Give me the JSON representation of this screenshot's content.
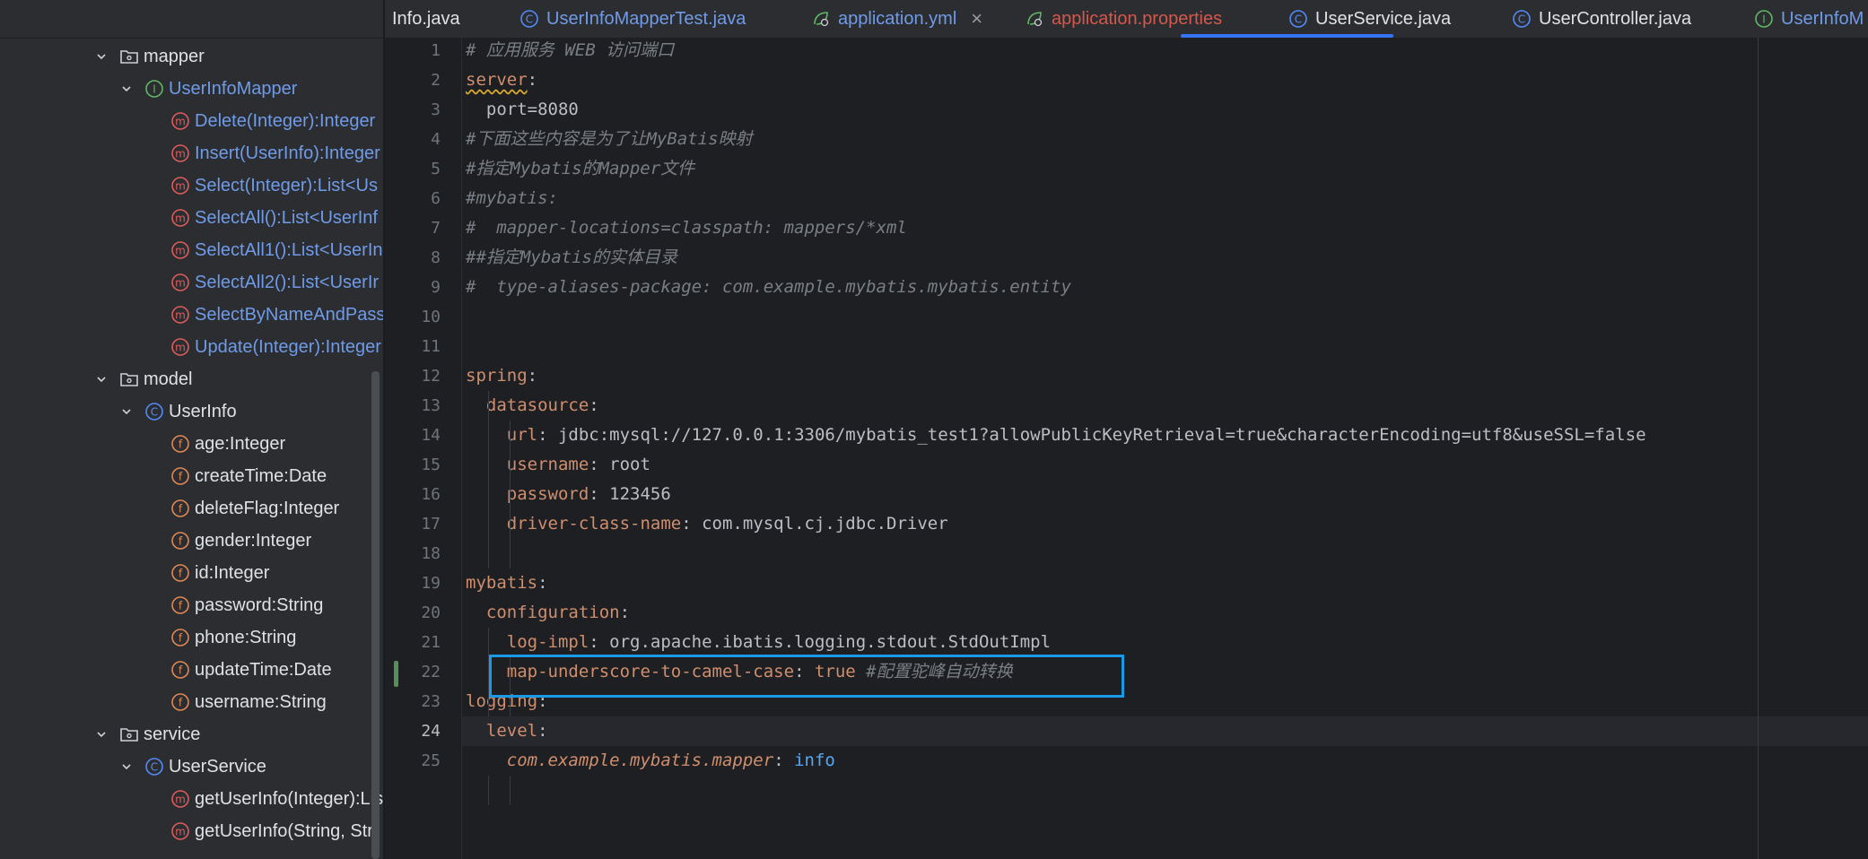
{
  "tabs": [
    {
      "label": "Info.java",
      "icon": "none",
      "color": "#dfe1e5"
    },
    {
      "label": "UserInfoMapperTest.java",
      "icon": "class-icon",
      "color": "#6f9be8"
    },
    {
      "label": "application.yml",
      "icon": "spring-config-icon",
      "color": "#6f9be8",
      "active": true,
      "close": "×"
    },
    {
      "label": "application.properties",
      "icon": "spring-config-icon",
      "color": "#d4584b"
    },
    {
      "label": "UserService.java",
      "icon": "class-icon",
      "color": "#dfe1e5"
    },
    {
      "label": "UserController.java",
      "icon": "class-icon",
      "color": "#dfe1e5"
    },
    {
      "label": "UserInfoM",
      "icon": "interface-icon",
      "color": "#6f9be8"
    }
  ],
  "tree": [
    {
      "label": "mapper",
      "type": "folder",
      "chevron": "down",
      "color": "#dfe1e5"
    },
    {
      "label": "UserInfoMapper",
      "type": "interface",
      "chevron": "down",
      "color": "#6f9be8"
    },
    {
      "label": "Delete(Integer):Integer",
      "type": "method",
      "color": "#6f9be8"
    },
    {
      "label": "Insert(UserInfo):Integer",
      "type": "method",
      "color": "#6f9be8"
    },
    {
      "label": "Select(Integer):List<Us",
      "type": "method",
      "color": "#6f9be8"
    },
    {
      "label": "SelectAll():List<UserInf",
      "type": "method",
      "color": "#6f9be8"
    },
    {
      "label": "SelectAll1():List<UserIn",
      "type": "method",
      "color": "#6f9be8"
    },
    {
      "label": "SelectAll2():List<UserIr",
      "type": "method",
      "color": "#6f9be8"
    },
    {
      "label": "SelectByNameAndPass",
      "type": "method",
      "color": "#6f9be8"
    },
    {
      "label": "Update(Integer):Integer",
      "type": "method",
      "color": "#6f9be8"
    },
    {
      "label": "model",
      "type": "folder",
      "chevron": "down",
      "color": "#dfe1e5"
    },
    {
      "label": "UserInfo",
      "type": "class",
      "chevron": "down",
      "color": "#dfe1e5"
    },
    {
      "label": "age:Integer",
      "type": "field",
      "color": "#dfe1e5"
    },
    {
      "label": "createTime:Date",
      "type": "field",
      "color": "#dfe1e5"
    },
    {
      "label": "deleteFlag:Integer",
      "type": "field",
      "color": "#dfe1e5"
    },
    {
      "label": "gender:Integer",
      "type": "field",
      "color": "#dfe1e5"
    },
    {
      "label": "id:Integer",
      "type": "field",
      "color": "#dfe1e5"
    },
    {
      "label": "password:String",
      "type": "field",
      "color": "#dfe1e5"
    },
    {
      "label": "phone:String",
      "type": "field",
      "color": "#dfe1e5"
    },
    {
      "label": "updateTime:Date",
      "type": "field",
      "color": "#dfe1e5"
    },
    {
      "label": "username:String",
      "type": "field",
      "color": "#dfe1e5"
    },
    {
      "label": "service",
      "type": "folder",
      "chevron": "down",
      "color": "#dfe1e5"
    },
    {
      "label": "UserService",
      "type": "class",
      "chevron": "down",
      "color": "#dfe1e5"
    },
    {
      "label": "getUserInfo(Integer):Lis",
      "type": "method",
      "color": "#dfe1e5"
    },
    {
      "label": "getUserInfo(String, Stri",
      "type": "method",
      "color": "#dfe1e5"
    }
  ],
  "editor": {
    "line_numbers": [
      "1",
      "2",
      "3",
      "4",
      "5",
      "6",
      "7",
      "8",
      "9",
      "10",
      "11",
      "12",
      "13",
      "14",
      "15",
      "16",
      "17",
      "18",
      "19",
      "20",
      "21",
      "22",
      "23",
      "24",
      "25"
    ],
    "current_line": "24",
    "lines": [
      [
        {
          "t": "# 应用服务 WEB 访问端口",
          "c": "comment"
        }
      ],
      [
        {
          "t": "server",
          "c": "key-wavy"
        },
        {
          "t": ":",
          "c": "plain"
        }
      ],
      [
        {
          "t": "  port=8080",
          "c": "plain"
        }
      ],
      [
        {
          "t": "#下面这些内容是为了让MyBatis映射",
          "c": "comment"
        }
      ],
      [
        {
          "t": "#指定Mybatis的Mapper文件",
          "c": "comment"
        }
      ],
      [
        {
          "t": "#mybatis:",
          "c": "comment"
        }
      ],
      [
        {
          "t": "#  mapper-locations=classpath: mappers/*xml",
          "c": "comment"
        }
      ],
      [
        {
          "t": "##指定Mybatis的实体目录",
          "c": "comment"
        }
      ],
      [
        {
          "t": "#  type-aliases-package: com.example.mybatis.mybatis.entity",
          "c": "comment"
        }
      ],
      [],
      [],
      [
        {
          "t": "spring",
          "c": "key"
        },
        {
          "t": ":",
          "c": "plain"
        }
      ],
      [
        {
          "t": "  ",
          "c": "plain"
        },
        {
          "t": "datasource",
          "c": "key"
        },
        {
          "t": ":",
          "c": "plain"
        }
      ],
      [
        {
          "t": "    ",
          "c": "plain"
        },
        {
          "t": "url",
          "c": "key"
        },
        {
          "t": ": jdbc:mysql://127.0.0.1:3306/mybatis_test1?allowPublicKeyRetrieval=true&characterEncoding=utf8&useSSL=false",
          "c": "plain"
        }
      ],
      [
        {
          "t": "    ",
          "c": "plain"
        },
        {
          "t": "username",
          "c": "key"
        },
        {
          "t": ": root",
          "c": "plain"
        }
      ],
      [
        {
          "t": "    ",
          "c": "plain"
        },
        {
          "t": "password",
          "c": "key"
        },
        {
          "t": ": 123456",
          "c": "plain"
        }
      ],
      [
        {
          "t": "    ",
          "c": "plain"
        },
        {
          "t": "driver-class-name",
          "c": "key"
        },
        {
          "t": ": com.mysql.cj.jdbc.Driver",
          "c": "plain"
        }
      ],
      [],
      [
        {
          "t": "mybatis",
          "c": "key"
        },
        {
          "t": ":",
          "c": "plain"
        }
      ],
      [
        {
          "t": "  ",
          "c": "plain"
        },
        {
          "t": "configuration",
          "c": "key"
        },
        {
          "t": ":",
          "c": "plain"
        }
      ],
      [
        {
          "t": "    ",
          "c": "plain"
        },
        {
          "t": "log-impl",
          "c": "key"
        },
        {
          "t": ": org.apache.ibatis.logging.stdout.StdOutImpl",
          "c": "plain"
        }
      ],
      [
        {
          "t": "    ",
          "c": "plain"
        },
        {
          "t": "map-underscore-to-camel-case",
          "c": "key"
        },
        {
          "t": ": ",
          "c": "plain"
        },
        {
          "t": "true",
          "c": "kw"
        },
        {
          "t": " #配置驼峰自动转换",
          "c": "comment"
        }
      ],
      [
        {
          "t": "logging",
          "c": "key"
        },
        {
          "t": ":",
          "c": "plain"
        }
      ],
      [
        {
          "t": "  ",
          "c": "plain"
        },
        {
          "t": "level",
          "c": "key"
        },
        {
          "t": ":",
          "c": "plain"
        }
      ],
      [
        {
          "t": "    ",
          "c": "plain"
        },
        {
          "t": "com.example.mybatis.mapper",
          "c": "pkg"
        },
        {
          "t": ": ",
          "c": "plain"
        },
        {
          "t": "info",
          "c": "info"
        }
      ]
    ]
  },
  "colors": {
    "highlight_box": "#1a9ae6",
    "accent": "#3574f0",
    "change_marker": "#549159"
  }
}
